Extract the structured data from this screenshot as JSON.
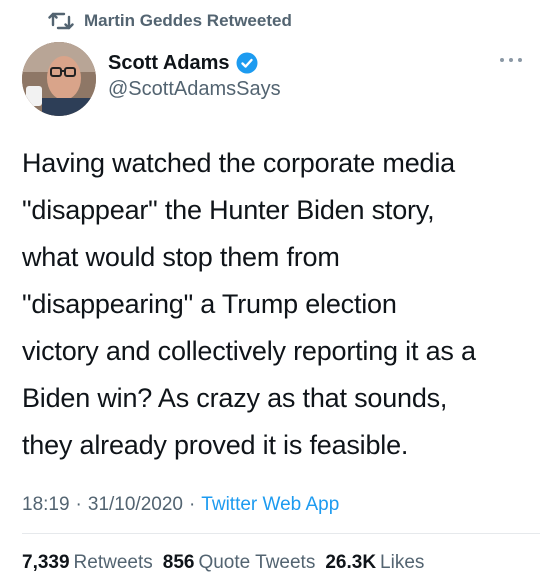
{
  "retweet": {
    "label": "Martin Geddes Retweeted",
    "icon": "retweet-icon"
  },
  "author": {
    "name": "Scott Adams",
    "handle": "@ScottAdamsSays",
    "verified": true,
    "verified_icon": "verified-badge-icon"
  },
  "tweet": {
    "lines": [
      "Having watched the corporate media",
      "\"disappear\" the Hunter Biden story,",
      "what would stop them from",
      "\"disappearing\" a Trump election",
      "victory and collectively reporting it as a",
      "Biden win? As crazy as that sounds,",
      "they already proved it is feasible."
    ]
  },
  "meta": {
    "time": "18:19",
    "date": "31/10/2020",
    "separator": "·",
    "source": "Twitter Web App"
  },
  "stats": {
    "retweets_count": "7,339",
    "retweets_label": "Retweets",
    "quotes_count": "856",
    "quotes_label": "Quote Tweets",
    "likes_count": "26.3K",
    "likes_label": "Likes"
  },
  "colors": {
    "text": "#0f1419",
    "secondary": "#536471",
    "accent": "#1d9bf0",
    "divider": "#e6e9ec"
  }
}
